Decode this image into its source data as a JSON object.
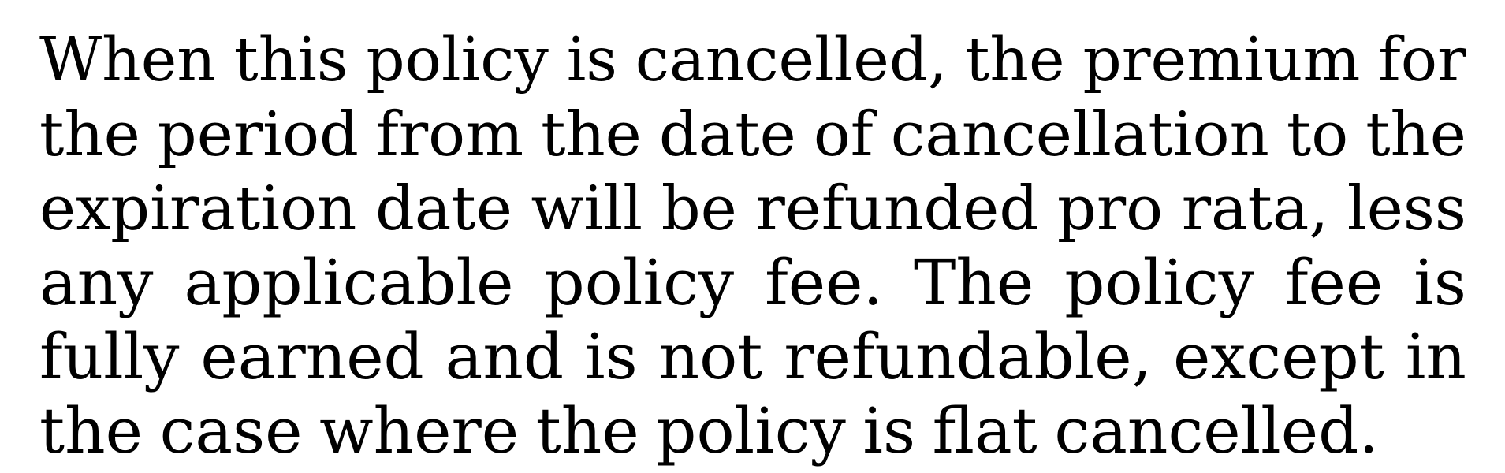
{
  "document": {
    "paragraph": {
      "lines": [
        [
          "When",
          "this",
          "policy",
          "is",
          "cancelled,",
          "the",
          "premium",
          "for"
        ],
        [
          "the",
          "period",
          "from",
          "the",
          "date",
          "of",
          "cancellation",
          "to",
          "the"
        ],
        [
          "expiration",
          "date",
          "will",
          "be",
          "refunded",
          "pro",
          "rata,",
          "less"
        ],
        [
          "any",
          "applicable",
          "policy",
          "fee.",
          "The",
          "policy",
          "fee",
          "is"
        ],
        [
          "fully",
          "earned",
          "and",
          "is",
          "not",
          "refundable,",
          "except",
          "in"
        ],
        [
          "the",
          "case",
          "where",
          "the",
          "policy",
          "is",
          "flat",
          "cancelled."
        ]
      ]
    }
  }
}
